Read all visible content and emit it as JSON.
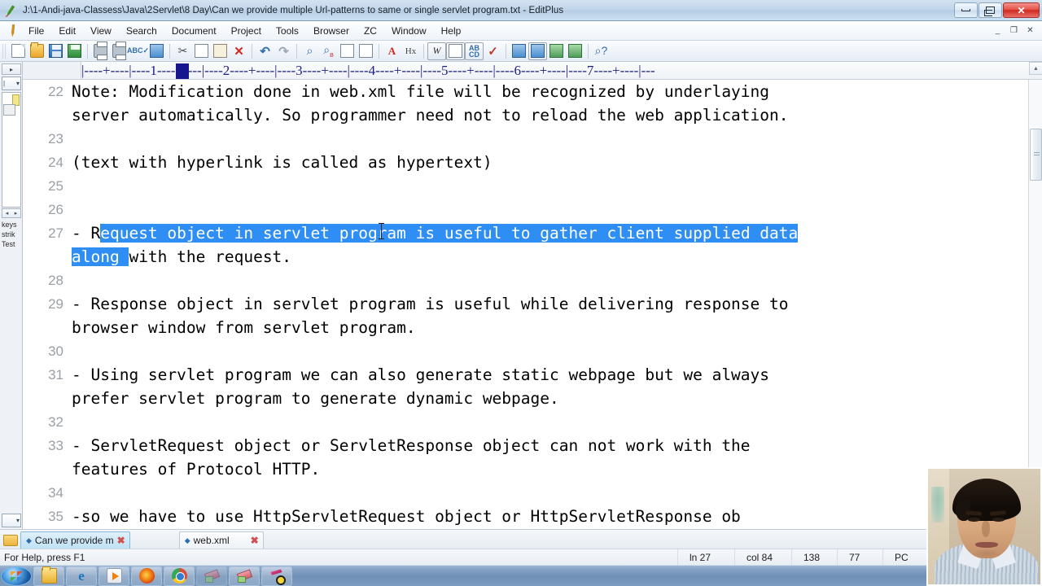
{
  "window": {
    "title": "J:\\1-Andi-java-Classess\\Java\\2Servlet\\8 Day\\Can we provide multiple Url-patterns to same or single servlet program.txt - EditPlus",
    "app_icon": "editplus-pen-icon",
    "buttons": {
      "minimize": "–",
      "maximize": "❐",
      "close": "✕"
    },
    "mdi_buttons": {
      "minimize": "_",
      "restore": "❐",
      "close": "✕"
    }
  },
  "menu": {
    "icon": "pencil-icon",
    "items": [
      "File",
      "Edit",
      "View",
      "Search",
      "Document",
      "Project",
      "Tools",
      "Browser",
      "ZC",
      "Window",
      "Help"
    ]
  },
  "toolbar": {
    "groups": [
      [
        {
          "name": "new-document-button",
          "glyph": "ic-doc",
          "label": "New"
        },
        {
          "name": "open-file-button",
          "glyph": "ic-folder",
          "label": "Open"
        },
        {
          "name": "save-button",
          "glyph": "ic-save",
          "label": "Save"
        },
        {
          "name": "save-all-button",
          "glyph": "ic-saveall",
          "label": "Save All"
        }
      ],
      [
        {
          "name": "print-preview-button",
          "glyph": "ic-print",
          "label": "Print Preview"
        },
        {
          "name": "print-button",
          "glyph": "ic-print",
          "label": "Print"
        },
        {
          "name": "spell-check-button",
          "glyph": "ic-abc",
          "label": "Spell Check",
          "text": "ABC"
        },
        {
          "name": "view-in-browser-button",
          "glyph": "ic-blue",
          "label": "View in Browser",
          "text": "<>"
        }
      ],
      [
        {
          "name": "cut-button",
          "glyph": "ic-scissor",
          "label": "Cut",
          "text": "✂"
        },
        {
          "name": "copy-button",
          "glyph": "ic-page",
          "label": "Copy"
        },
        {
          "name": "paste-button",
          "glyph": "ic-clip",
          "label": "Paste"
        },
        {
          "name": "delete-button",
          "glyph": "ic-xred",
          "label": "Delete",
          "text": "✕"
        }
      ],
      [
        {
          "name": "undo-button",
          "glyph": "ic-undo",
          "label": "Undo",
          "text": "↶"
        },
        {
          "name": "redo-button",
          "glyph": "ic-redo",
          "label": "Redo",
          "text": "↷"
        }
      ],
      [
        {
          "name": "find-button",
          "glyph": "ic-find",
          "label": "Find",
          "text": "⌕"
        },
        {
          "name": "replace-button",
          "glyph": "ic-find",
          "label": "Replace",
          "text": "⌕"
        },
        {
          "name": "find-in-files-button",
          "glyph": "ic-page",
          "label": "Find in Files"
        },
        {
          "name": "goto-line-button",
          "glyph": "ic-page",
          "label": "Go To Line"
        }
      ],
      [
        {
          "name": "font-button",
          "glyph": "ic-A",
          "label": "Font",
          "text": "A"
        },
        {
          "name": "hex-view-button",
          "glyph": "ic-hx",
          "label": "Hex Viewer",
          "text": "Hx"
        }
      ],
      [
        {
          "name": "word-wrap-button",
          "glyph": "ic-W",
          "label": "Word Wrap",
          "text": "W",
          "active": true
        },
        {
          "name": "line-number-button",
          "glyph": "ic-page",
          "label": "Line Numbers",
          "active": true
        },
        {
          "name": "show-spaces-button",
          "glyph": "ic-abc",
          "label": "Show Spaces",
          "text": "AB\\nCD",
          "active": true
        },
        {
          "name": "spell-ok-button",
          "glyph": "ic-check",
          "label": "Check Spelling",
          "text": "✔"
        }
      ],
      [
        {
          "name": "toggle-output-window-button",
          "glyph": "ic-blue",
          "label": "Output Window"
        },
        {
          "name": "toggle-directory-window-button",
          "glyph": "ic-blue",
          "label": "Directory Window",
          "active": true
        },
        {
          "name": "toggle-cliptext-button",
          "glyph": "ic-green",
          "label": "Cliptext Window"
        },
        {
          "name": "toggle-document-selector-button",
          "glyph": "ic-green",
          "label": "Document Selector"
        }
      ],
      [
        {
          "name": "context-help-button",
          "glyph": "ic-find",
          "label": "Context Help",
          "text": "⌕?"
        }
      ]
    ]
  },
  "sidebar": {
    "toggle_label": "▸",
    "combo_label": "▾",
    "arrows": {
      "left": "◂",
      "right": "▸"
    },
    "cliptext_words": [
      "keys",
      "strik",
      "Test"
    ],
    "bottom_combo_label": "▾",
    "expand_arrow": "play-arrow"
  },
  "ruler": {
    "marks": "|----+----|----1----+----|----2----+----|----3----+----|----4----+----|----5----+----|----6----+----|----7----+----|---",
    "cursor_column_indicator": true
  },
  "editor": {
    "font": "monospace",
    "selection_color": "#2f8ef4",
    "lines": [
      {
        "number": "22",
        "segments": [
          {
            "text": "Note: Modification done in web.xml file will be recognized by underlaying",
            "selected": false
          }
        ]
      },
      {
        "number": "",
        "segments": [
          {
            "text": "server automatically. So programmer need not to reload the web application.",
            "selected": false
          }
        ]
      },
      {
        "number": "23",
        "segments": [
          {
            "text": "",
            "selected": false
          }
        ]
      },
      {
        "number": "24",
        "segments": [
          {
            "text": "(text with hyperlink is called as hypertext)",
            "selected": false
          }
        ]
      },
      {
        "number": "25",
        "segments": [
          {
            "text": "",
            "selected": false
          }
        ]
      },
      {
        "number": "26",
        "segments": [
          {
            "text": "",
            "selected": false
          }
        ]
      },
      {
        "number": "27",
        "segments": [
          {
            "text": "- R",
            "selected": false
          },
          {
            "text": "equest object in servlet program is useful to gather client supplied data",
            "selected": true
          }
        ]
      },
      {
        "number": "",
        "segments": [
          {
            "text": "along ",
            "selected": true
          },
          {
            "text": "with the request.",
            "selected": false
          }
        ]
      },
      {
        "number": "28",
        "segments": [
          {
            "text": "",
            "selected": false
          }
        ]
      },
      {
        "number": "29",
        "segments": [
          {
            "text": "- Response object in servlet program is useful while delivering response to",
            "selected": false
          }
        ]
      },
      {
        "number": "",
        "segments": [
          {
            "text": "browser window from servlet program.",
            "selected": false
          }
        ]
      },
      {
        "number": "30",
        "segments": [
          {
            "text": "",
            "selected": false
          }
        ]
      },
      {
        "number": "31",
        "segments": [
          {
            "text": "- Using servlet program we can also generate static webpage but we always",
            "selected": false
          }
        ]
      },
      {
        "number": "",
        "segments": [
          {
            "text": "prefer servlet program to generate dynamic webpage.",
            "selected": false
          }
        ]
      },
      {
        "number": "32",
        "segments": [
          {
            "text": "",
            "selected": false
          }
        ]
      },
      {
        "number": "33",
        "segments": [
          {
            "text": "- ServletRequest object or ServletResponse object can not work with the",
            "selected": false
          }
        ]
      },
      {
        "number": "",
        "segments": [
          {
            "text": "features of Protocol HTTP.",
            "selected": false
          }
        ]
      },
      {
        "number": "34",
        "segments": [
          {
            "text": "",
            "selected": false
          }
        ]
      },
      {
        "number": "35",
        "segments": [
          {
            "text": "-so we have to use HttpServletRequest object or HttpServletResponse ob",
            "selected": false
          }
        ]
      }
    ]
  },
  "tabs": [
    {
      "name": "tab-text-file",
      "label": "Can we provide m",
      "active": true,
      "close": "✖",
      "marker": "◆"
    },
    {
      "name": "tab-web-xml",
      "label": "web.xml",
      "active": false,
      "close": "✖",
      "marker": "◆"
    }
  ],
  "statusbar": {
    "help": "For Help, press F1",
    "line": "ln 27",
    "col": "col 84",
    "value1": "138",
    "value2": "77",
    "mode": "PC"
  },
  "taskbar": {
    "start_label": "Start",
    "items": [
      {
        "name": "taskbar-windows-explorer",
        "icon": "ti-explorer"
      },
      {
        "name": "taskbar-internet-explorer",
        "icon": "ti-ie",
        "text": "e"
      },
      {
        "name": "taskbar-windows-media-player",
        "icon": "ti-wmp"
      },
      {
        "name": "taskbar-firefox",
        "icon": "ti-ff"
      },
      {
        "name": "taskbar-google-chrome",
        "icon": "ti-chrome"
      },
      {
        "name": "taskbar-eraser-app",
        "icon": "ti-eraser"
      },
      {
        "name": "taskbar-editplus",
        "icon": "ti-editplus"
      },
      {
        "name": "taskbar-screen-recorder",
        "icon": "ti-editplus"
      }
    ]
  },
  "webcam": {
    "name": "webcam-overlay",
    "description": "presenter video feed"
  }
}
